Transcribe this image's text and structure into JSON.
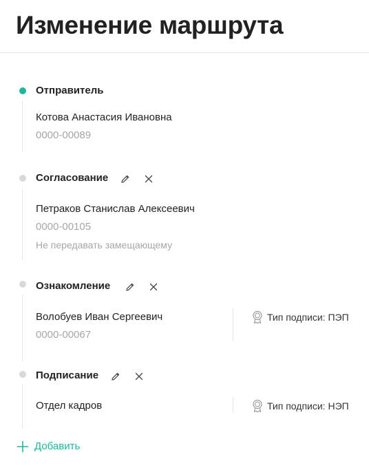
{
  "page": {
    "title": "Изменение маршрута"
  },
  "steps": [
    {
      "title": "Отправитель",
      "person": "Котова Анастасия Ивановна",
      "code": "0000-00089",
      "status": "active"
    },
    {
      "title": "Согласование",
      "person": "Петраков Станислав Алексеевич",
      "code": "0000-00105",
      "note": "Не передавать замещающему"
    },
    {
      "title": "Ознакомление",
      "person": "Волобуев Иван Сергеевич",
      "code": "0000-00067",
      "signature": "Тип подписи: ПЭП"
    },
    {
      "title": "Подписание",
      "person": "Отдел кадров",
      "signature": "Тип подписи: НЭП"
    }
  ],
  "actions": {
    "add_label": "Добавить"
  },
  "colors": {
    "accent": "#1bb99a",
    "inactive_dot": "#d9d9d9",
    "muted_text": "#a6a6a6"
  },
  "icons": {
    "edit": "pencil-icon",
    "remove": "close-icon",
    "signature": "award-badge-icon",
    "add": "plus-icon"
  }
}
